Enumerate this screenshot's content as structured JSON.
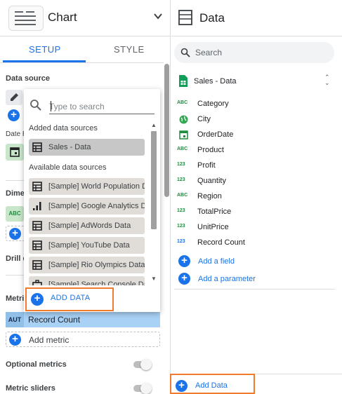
{
  "left_panel": {
    "title": "Chart",
    "tabs": [
      {
        "label": "SETUP",
        "active": true
      },
      {
        "label": "STYLE",
        "active": false
      }
    ],
    "sections": {
      "data_source": "Data source",
      "date_range": "Date R",
      "dimension": "Dimer",
      "drill_down": "Drill d",
      "metric": "Metri",
      "optional_metrics": "Optional metrics",
      "metric_sliders": "Metric sliders"
    },
    "metric": {
      "type_badge": "AUT",
      "name": "Record Count"
    },
    "add_metric_label": "Add metric",
    "dimension_badge": "ABC"
  },
  "dropdown": {
    "search_placeholder": "Type to search",
    "added_header": "Added data sources",
    "added": [
      {
        "label": "Sales - Data",
        "icon": "table-icon"
      }
    ],
    "available_header": "Available data sources",
    "available": [
      {
        "label": "[Sample] World Population Data",
        "icon": "table-icon"
      },
      {
        "label": "[Sample] Google Analytics Data",
        "icon": "bar-chart-icon"
      },
      {
        "label": "[Sample] AdWords Data",
        "icon": "table-icon"
      },
      {
        "label": "[Sample] YouTube Data",
        "icon": "table-icon"
      },
      {
        "label": "[Sample] Rio Olympics Data",
        "icon": "table-icon"
      },
      {
        "label": "[Sample] Search Console Data",
        "icon": "briefcase-icon"
      }
    ],
    "add_data_label": "ADD DATA"
  },
  "right_panel": {
    "title": "Data",
    "search_placeholder": "Search",
    "source_name": "Sales - Data",
    "fields": [
      {
        "type": "ABC",
        "name": "Category",
        "kind": "text"
      },
      {
        "type": "globe",
        "name": "City",
        "kind": "geo"
      },
      {
        "type": "calendar",
        "name": "OrderDate",
        "kind": "date"
      },
      {
        "type": "ABC",
        "name": "Product",
        "kind": "text"
      },
      {
        "type": "123",
        "name": "Profit",
        "kind": "number"
      },
      {
        "type": "123",
        "name": "Quantity",
        "kind": "number"
      },
      {
        "type": "ABC",
        "name": "Region",
        "kind": "text"
      },
      {
        "type": "123",
        "name": "TotalPrice",
        "kind": "number"
      },
      {
        "type": "123",
        "name": "UnitPrice",
        "kind": "number"
      },
      {
        "type": "123",
        "name": "Record Count",
        "kind": "metric"
      }
    ],
    "add_field_label": "Add a field",
    "add_parameter_label": "Add a parameter",
    "add_data_label": "Add Data"
  },
  "colors": {
    "accent": "#1a73e8",
    "dimension_green": "#1e8e3e",
    "highlight_orange": "#f07b2f",
    "metric_blue": "#a8d1f5"
  }
}
